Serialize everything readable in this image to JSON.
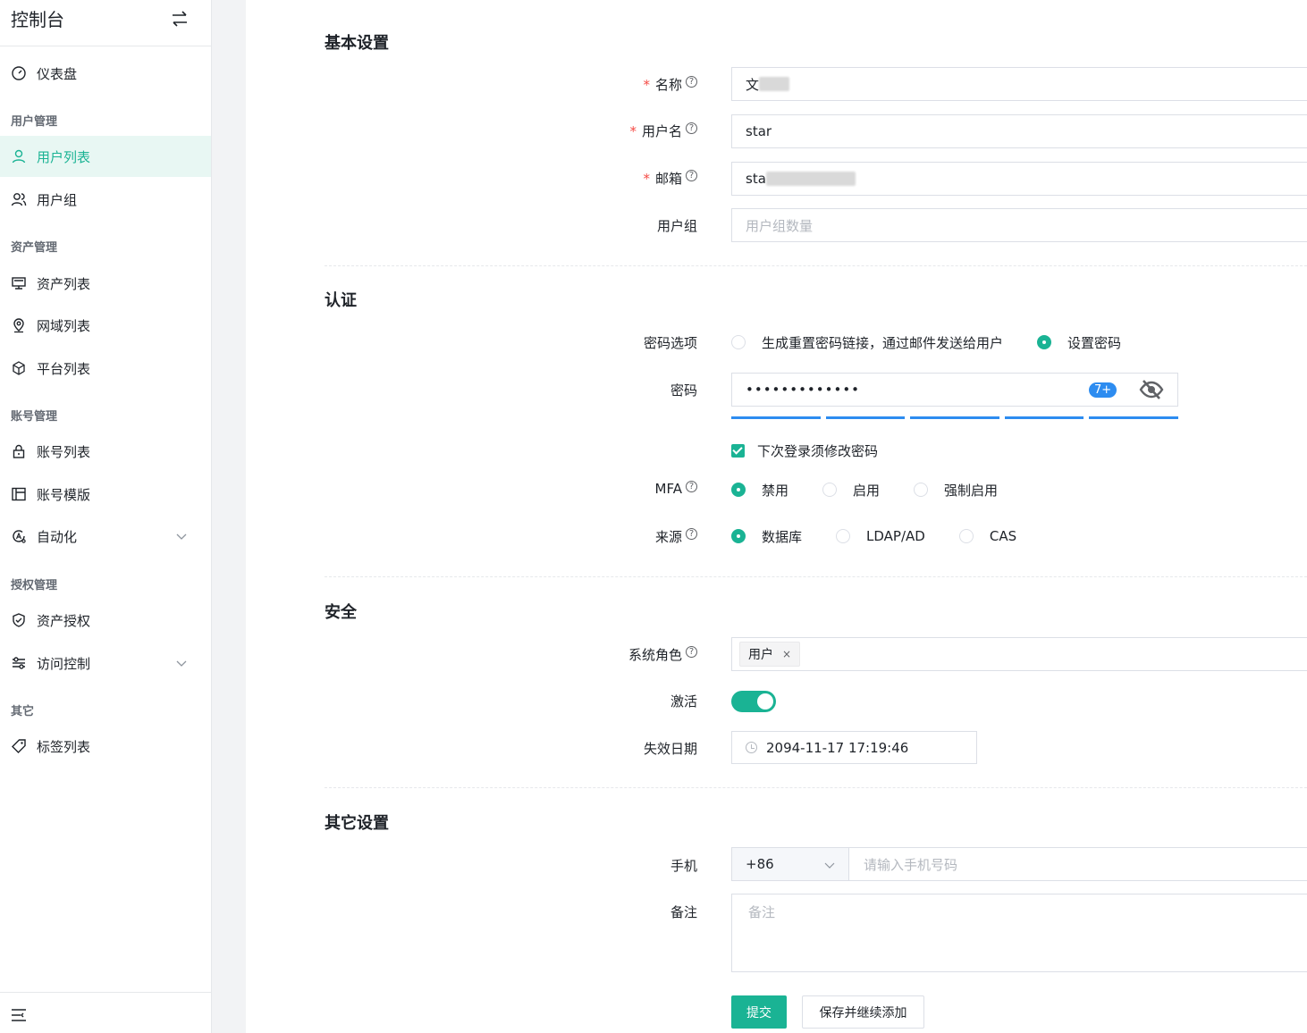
{
  "sidebar": {
    "title": "控制台",
    "items": {
      "dashboard": "仪表盘",
      "user_list": "用户列表",
      "user_group": "用户组",
      "asset_list": "资产列表",
      "domain_list": "网域列表",
      "platform_list": "平台列表",
      "account_list": "账号列表",
      "account_template": "账号模版",
      "automation": "自动化",
      "asset_permission": "资产授权",
      "access_control": "访问控制",
      "tag_list": "标签列表"
    },
    "groups": {
      "user_mgmt": "用户管理",
      "asset_mgmt": "资产管理",
      "account_mgmt": "账号管理",
      "perm_mgmt": "授权管理",
      "other": "其它"
    },
    "active_item": "user_list"
  },
  "form": {
    "basic": {
      "title": "基本设置",
      "name_label": "名称",
      "name_value": "文",
      "username_label": "用户名",
      "username_value": "star",
      "email_label": "邮箱",
      "email_value": "sta",
      "group_label": "用户组",
      "group_placeholder": "用户组数量"
    },
    "auth": {
      "title": "认证",
      "pwd_option_label": "密码选项",
      "pwd_options": [
        "生成重置密码链接，通过邮件发送给用户",
        "设置密码"
      ],
      "pwd_option_selected": "设置密码",
      "pwd_label": "密码",
      "pwd_value": "•••••••••••••",
      "pwd_badge": "7+",
      "pwd_strength_segments": 5,
      "pwd_strength_filled": 5,
      "must_change_label": "下次登录须修改密码",
      "must_change_checked": true,
      "mfa_label": "MFA",
      "mfa_options": [
        "禁用",
        "启用",
        "强制启用"
      ],
      "mfa_selected": "禁用",
      "source_label": "来源",
      "source_options": [
        "数据库",
        "LDAP/AD",
        "CAS"
      ],
      "source_selected": "数据库"
    },
    "security": {
      "title": "安全",
      "role_label": "系统角色",
      "role_tag": "用户",
      "role_tag_close": "×",
      "active_label": "激活",
      "active_on": true,
      "expire_label": "失效日期",
      "expire_value": "2094-11-17 17:19:46"
    },
    "other": {
      "title": "其它设置",
      "phone_label": "手机",
      "phone_code": "+86",
      "phone_placeholder": "请输入手机号码",
      "comment_label": "备注",
      "comment_placeholder": "备注"
    },
    "buttons": {
      "submit": "提交",
      "save_continue": "保存并继续添加"
    },
    "required_mark": "*",
    "help_mark": "?"
  },
  "colors": {
    "accent": "#1ab394",
    "danger": "#f54a45",
    "strength": "#2d8cf0"
  }
}
